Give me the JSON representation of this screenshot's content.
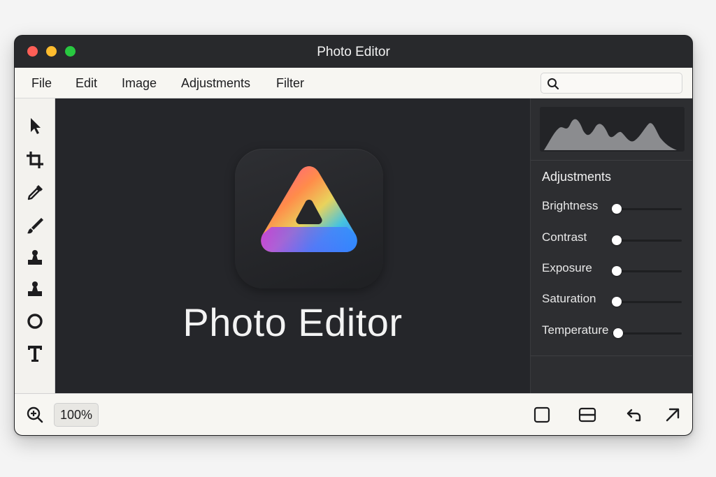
{
  "window": {
    "title": "Photo Editor"
  },
  "menu": {
    "items": [
      "File",
      "Edit",
      "Image",
      "Adjustments",
      "Filter"
    ]
  },
  "search": {
    "icon": "search-icon",
    "value": "",
    "placeholder": ""
  },
  "tools": [
    {
      "name": "select-tool",
      "icon": "pointer-arrow-icon"
    },
    {
      "name": "crop-tool",
      "icon": "crop-icon"
    },
    {
      "name": "eyedropper-tool",
      "icon": "eyedropper-icon"
    },
    {
      "name": "brush-tool",
      "icon": "brush-icon"
    },
    {
      "name": "stamp-tool",
      "icon": "stamp-icon"
    },
    {
      "name": "stamp-tool-2",
      "icon": "stamp-icon"
    },
    {
      "name": "ellipse-tool",
      "icon": "circle-icon"
    },
    {
      "name": "text-tool",
      "icon": "text-icon"
    }
  ],
  "canvas": {
    "app_name": "Photo Editor",
    "logo_gradient": [
      "#ff5fa2",
      "#ff9a3c",
      "#f7d64a",
      "#5ad1c8",
      "#3a7bff",
      "#b23cff"
    ]
  },
  "panel": {
    "heading": "Adjustments",
    "sliders": [
      {
        "label": "Brightness",
        "value": 0.0
      },
      {
        "label": "Contrast",
        "value": 0.0
      },
      {
        "label": "Exposure",
        "value": 0.0
      },
      {
        "label": "Saturation",
        "value": 0.0
      },
      {
        "label": "Temperature",
        "value": 0.0
      }
    ]
  },
  "statusbar": {
    "zoom": "100%",
    "zoom_icon": "zoom-in-icon",
    "actions": [
      {
        "name": "single-view-button",
        "icon": "square-icon"
      },
      {
        "name": "split-view-button",
        "icon": "split-horizontal-icon"
      },
      {
        "name": "undo-button",
        "icon": "undo-arrow-icon"
      },
      {
        "name": "export-button",
        "icon": "arrow-up-right-icon"
      }
    ]
  },
  "colors": {
    "window_dark": "#2a2b2e",
    "chrome_light": "#f7f6f2",
    "traffic_red": "#ff5f57",
    "traffic_yellow": "#febc2e",
    "traffic_green": "#28c840"
  }
}
